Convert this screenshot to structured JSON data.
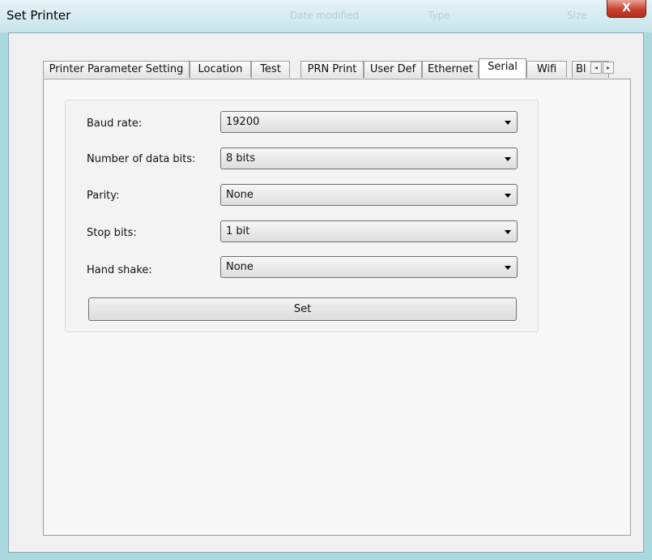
{
  "window": {
    "title": "Set Printer",
    "close_glyph": "X",
    "background_headers": [
      "Date modified",
      "Type",
      "Size"
    ]
  },
  "tabs": [
    {
      "label": "Printer Parameter Setting",
      "active": false
    },
    {
      "label": "Location",
      "active": false
    },
    {
      "label": "Test",
      "active": false
    },
    {
      "label": "PRN Print",
      "active": false
    },
    {
      "label": "User Def",
      "active": false
    },
    {
      "label": "Ethernet",
      "active": false
    },
    {
      "label": "Serial",
      "active": true
    },
    {
      "label": "Wifi",
      "active": false
    },
    {
      "label": "Bl",
      "active": false
    }
  ],
  "tab_scroll": {
    "left_glyph": "◂",
    "right_glyph": "▸"
  },
  "serial": {
    "baud_rate": {
      "label": "Baud rate:",
      "value": "19200"
    },
    "data_bits": {
      "label": "Number of data bits:",
      "value": "8 bits"
    },
    "parity": {
      "label": "Parity:",
      "value": "None"
    },
    "stop_bits": {
      "label": "Stop bits:",
      "value": "1 bit"
    },
    "hand_shake": {
      "label": "Hand shake:",
      "value": "None"
    },
    "set_label": "Set"
  },
  "colors": {
    "desktop": "#a9d8de",
    "close_button": "#c7412e",
    "panel": "#f0f0f0"
  }
}
